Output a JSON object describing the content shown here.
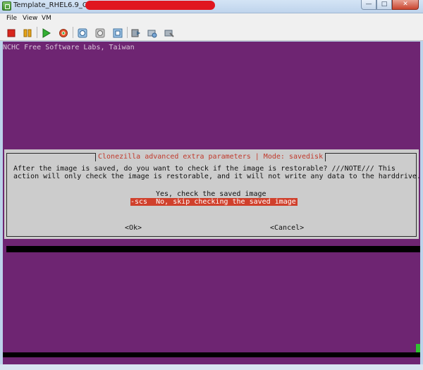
{
  "window": {
    "title": "Template_RHEL6.9_OS_x64",
    "controls": {
      "minimize": "—",
      "maximize": "□",
      "close": "✕"
    },
    "redaction_color": "#e0161f"
  },
  "menu": [
    "File",
    "View",
    "VM"
  ],
  "toolbar": {
    "icons": [
      "stop-icon",
      "pause-icon",
      "play-icon",
      "reset-icon",
      "snapshot-icon",
      "revert-snapshot-icon",
      "snapshot-manager-icon",
      "send-keys-icon",
      "settings-icon",
      "wrench-icon"
    ]
  },
  "console": {
    "header": "NCHC Free Software Labs, Taiwan",
    "background": "#6e2572",
    "dialog": {
      "title": "Clonezilla advanced extra parameters | Mode: savedisk",
      "body_line1": "After the image is saved, do you want to check if the image is restorable? ///NOTE/// This",
      "body_line2": "action will only check the image is restorable, and it will not write any data to the harddrive.",
      "options": [
        {
          "tag": "",
          "label": "Yes, check the saved image",
          "selected": false
        },
        {
          "tag": "-scs",
          "label": "No, skip checking the saved image",
          "selected": true
        }
      ],
      "ok_label": "<Ok>",
      "cancel_label": "<Cancel>",
      "highlight_color": "#d0402c"
    }
  }
}
